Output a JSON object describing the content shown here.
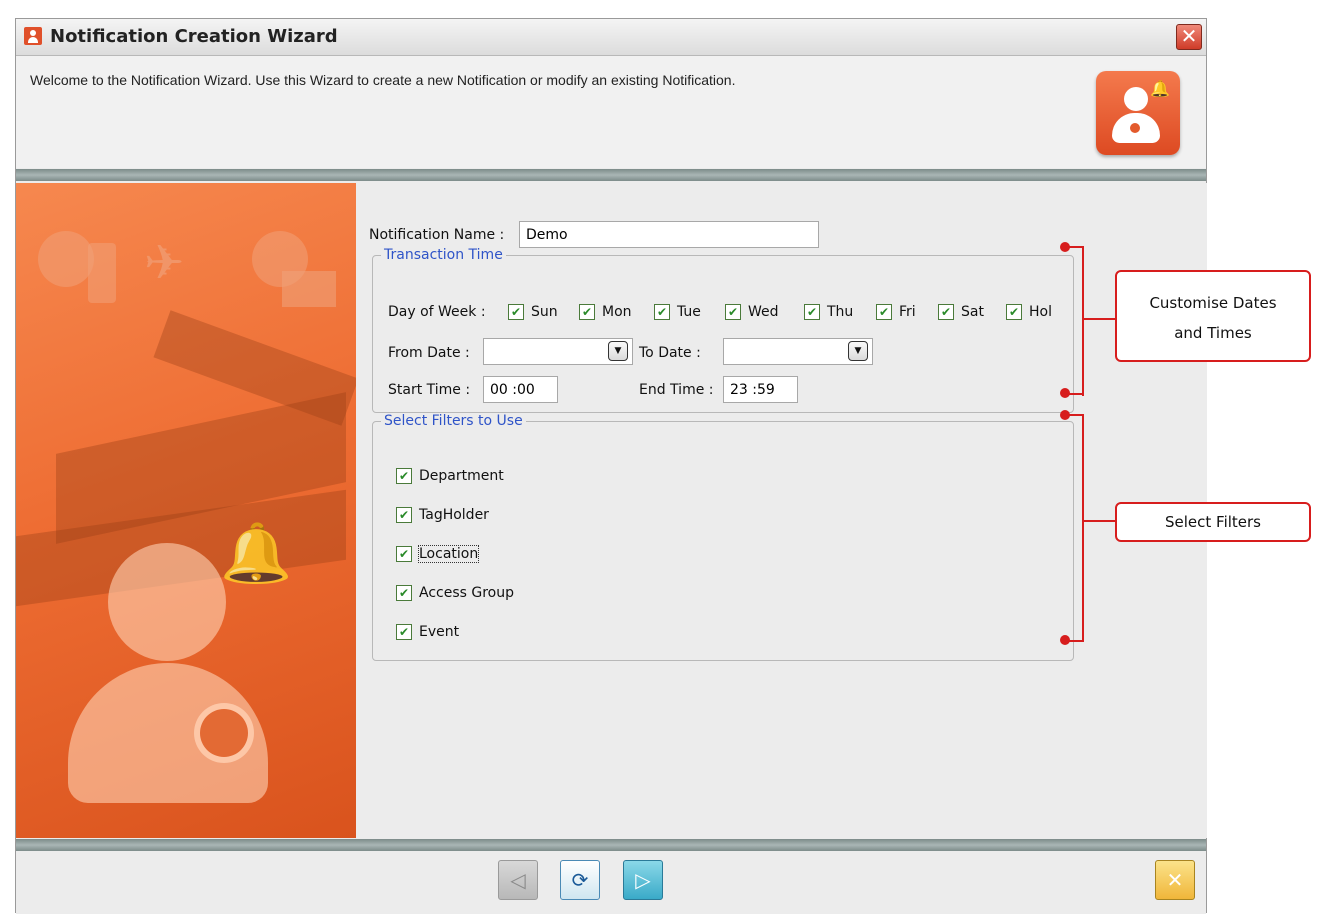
{
  "window": {
    "title": "Notification Creation Wizard",
    "title_icon": "notification-wizard-icon",
    "close_icon": "close-icon",
    "close_glyph": "✕"
  },
  "header": {
    "welcome_text": "Welcome to the Notification Wizard.  Use this Wizard to create a new Notification or modify an existing Notification.",
    "icon": "notification-user-icon",
    "bell_glyph": "♪"
  },
  "form": {
    "notification_name_label": "Notification Name :",
    "notification_name_value": "Demo",
    "transaction_time": {
      "legend": "Transaction Time",
      "day_of_week_label": "Day of Week :",
      "days": [
        {
          "label": "Sun",
          "checked": true
        },
        {
          "label": "Mon",
          "checked": true
        },
        {
          "label": "Tue",
          "checked": true
        },
        {
          "label": "Wed",
          "checked": true
        },
        {
          "label": "Thu",
          "checked": true
        },
        {
          "label": "Fri",
          "checked": true
        },
        {
          "label": "Sat",
          "checked": true
        },
        {
          "label": "Hol",
          "checked": true
        }
      ],
      "from_date_label": "From Date :",
      "from_date_value": "",
      "to_date_label": "To Date :",
      "to_date_value": "",
      "start_time_label": "Start Time :",
      "start_time_value": "00 :00",
      "end_time_label": "End Time :",
      "end_time_value": "23 :59",
      "dropdown_glyph": "▼"
    },
    "filters": {
      "legend": "Select Filters to Use",
      "items": [
        {
          "label": "Department",
          "checked": true
        },
        {
          "label": "TagHolder",
          "checked": true
        },
        {
          "label": "Location",
          "checked": true
        },
        {
          "label": "Access Group",
          "checked": true
        },
        {
          "label": "Event",
          "checked": true
        }
      ]
    },
    "check_glyph": "✔"
  },
  "footer": {
    "back_icon": "back-arrow-icon",
    "back_glyph": "◁",
    "refresh_icon": "refresh-icon",
    "refresh_glyph": "⟳",
    "next_icon": "next-arrow-icon",
    "next_glyph": "▷",
    "cancel_icon": "cancel-icon",
    "cancel_glyph": "✕"
  },
  "annotations": {
    "dates_times_line1": "Customise Dates",
    "dates_times_line2": "and Times",
    "filters": "Select Filters"
  },
  "colors": {
    "accent_orange": "#ee6d33",
    "legend_blue": "#2f54c8",
    "annotation_red": "#d71d1d"
  }
}
